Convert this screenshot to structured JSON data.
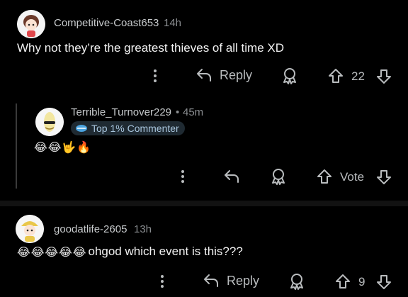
{
  "comments": [
    {
      "username": "Competitive-Coast653",
      "time": "14h",
      "text": "Why not they’re the greatest thieves of all time XD",
      "reply_label": "Reply",
      "score": "22"
    },
    {
      "username": "Terrible_Turnover229",
      "time_sep": "•",
      "time": "45m",
      "badge": "Top 1% Commenter",
      "emojis": "😂😂🤟🔥",
      "vote_label": "Vote"
    },
    {
      "username": "goodatlife-2605",
      "time": "13h",
      "emojis": "😂😂😂😂😂",
      "text": "ohgod which event is this???",
      "reply_label": "Reply",
      "score": "9"
    }
  ],
  "icons": {
    "more": "more-vertical-icon",
    "reply": "reply-arrow-icon",
    "award": "award-icon",
    "upvote": "upvote-arrow-icon",
    "downvote": "downvote-arrow-icon"
  },
  "colors": {
    "background": "#000000",
    "text": "#f2f2f2",
    "meta": "#8a8d90",
    "badge_bg": "#1f2a32",
    "badge_text": "#a9c6de"
  }
}
